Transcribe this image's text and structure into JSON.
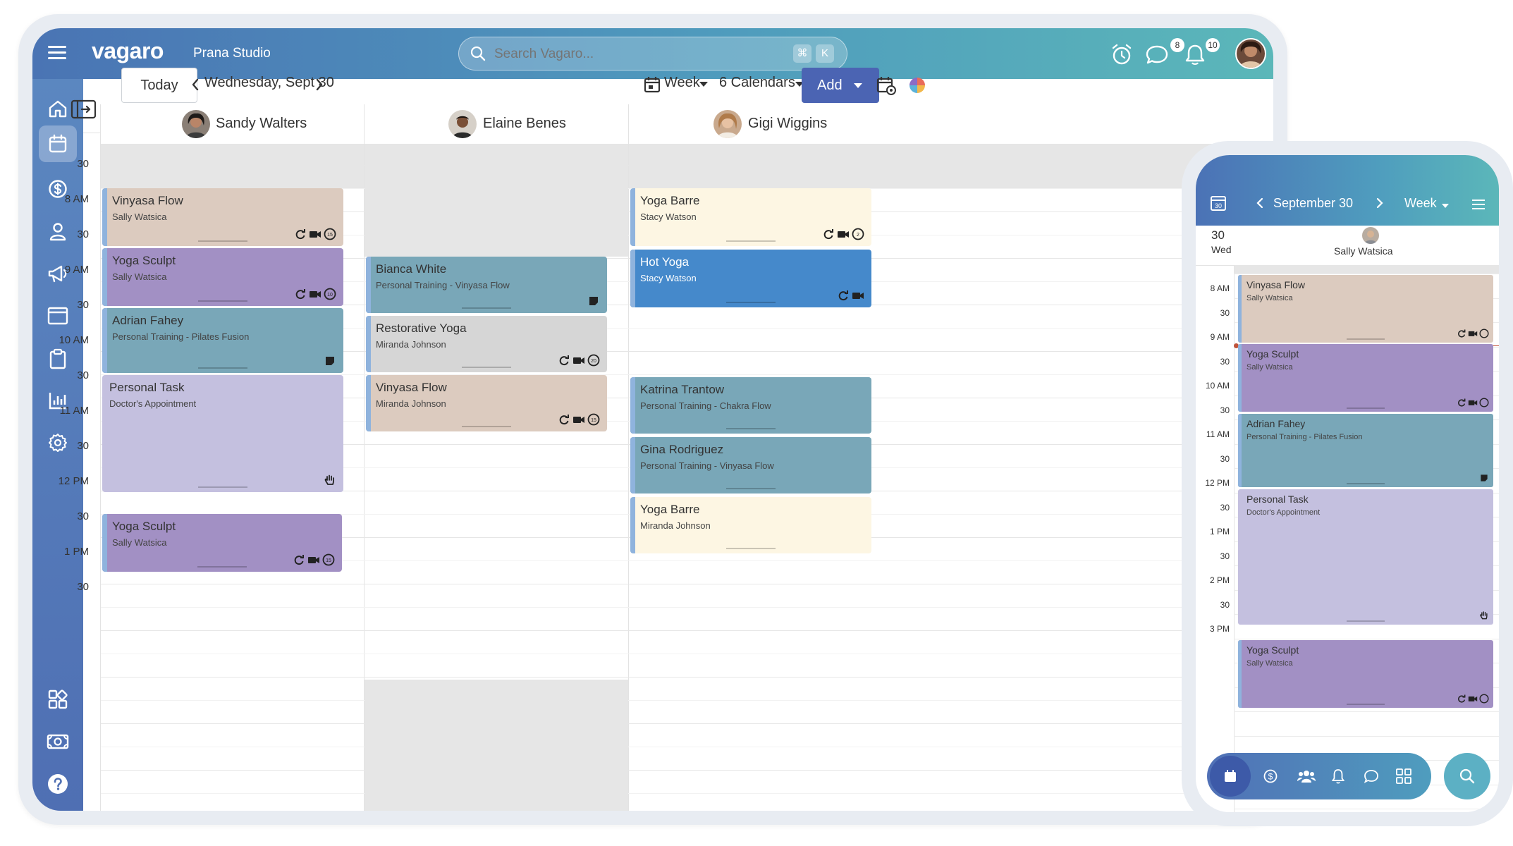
{
  "header": {
    "brand": "vagaro",
    "studio": "Prana Studio",
    "search_placeholder": "Search Vagaro...",
    "shortcut_keys": [
      "⌘",
      "K"
    ],
    "messages_badge": "8",
    "notifications_badge": "10"
  },
  "toolbar": {
    "today_label": "Today",
    "date_label": "Wednesday, Sept 30",
    "view_label": "Week",
    "calendars_label": "6 Calendars",
    "add_label": "Add"
  },
  "columns": [
    {
      "name": "Sandy Walters"
    },
    {
      "name": "Elaine Benes"
    },
    {
      "name": "Gigi Wiggins"
    }
  ],
  "time_labels": [
    "30",
    "8 AM",
    "30",
    "9 AM",
    "30",
    "10 AM",
    "30",
    "11 AM",
    "30",
    "12 PM",
    "30",
    "1 PM",
    "30"
  ],
  "appointments": [
    {
      "title": "Vinyasa Flow",
      "sub": "Sally Watsica",
      "icon_num": "15"
    },
    {
      "title": "Yoga Sculpt",
      "sub": "Sally Watsica",
      "icon_num": "10"
    },
    {
      "title": "Adrian Fahey",
      "sub": "Personal Training - Pilates Fusion"
    },
    {
      "title": "Personal Task",
      "sub": "Doctor's Appointment"
    },
    {
      "title": "Yoga Sculpt",
      "sub": "Sally Watsica",
      "icon_num": "15"
    },
    {
      "title": "Bianca White",
      "sub": "Personal Training - Vinyasa Flow"
    },
    {
      "title": "Restorative Yoga",
      "sub": "Miranda Johnson",
      "icon_num": "20"
    },
    {
      "title": "Vinyasa Flow",
      "sub": "Miranda Johnson",
      "icon_num": "15"
    },
    {
      "title": "Yoga Barre",
      "sub": "Stacy Watson",
      "icon_num": "2"
    },
    {
      "title": "Hot Yoga",
      "sub": "Stacy Watson"
    },
    {
      "title": "Katrina Trantow",
      "sub": "Personal Training - Chakra Flow"
    },
    {
      "title": "Gina Rodriguez",
      "sub": "Personal Training - Vinyasa Flow"
    },
    {
      "title": "Yoga Barre",
      "sub": "Miranda Johnson"
    }
  ],
  "colors": {
    "tan": "#dccbbf",
    "purple": "#a290c4",
    "teal": "#79a7b8",
    "lavender": "#c4c0df",
    "gray": "#d6d6d6",
    "cream": "#fdf6e3",
    "blue": "#4589cb",
    "add_button": "#4b64b3"
  },
  "phone": {
    "calendar_day": "30",
    "month_label": "September 30",
    "view_label": "Week",
    "day_num": "30",
    "day_name": "Wed",
    "staff_name": "Sally Watsica",
    "time_labels": [
      "8 AM",
      "30",
      "9 AM",
      "30",
      "10 AM",
      "30",
      "11 AM",
      "30",
      "12 PM",
      "30",
      "1 PM",
      "30",
      "2 PM",
      "30",
      "3 PM"
    ],
    "appointments": [
      {
        "title": "Vinyasa Flow",
        "sub": "Sally Watsica"
      },
      {
        "title": "Yoga Sculpt",
        "sub": "Sally Watsica"
      },
      {
        "title": "Adrian Fahey",
        "sub": "Personal Training - Pilates Fusion"
      },
      {
        "title": "Personal Task",
        "sub": "Doctor's Appointment"
      },
      {
        "title": "Yoga Sculpt",
        "sub": "Sally Watsica"
      }
    ]
  },
  "icons": {
    "sidebar": [
      "home-icon",
      "calendar-icon",
      "dollar-icon",
      "user-icon",
      "megaphone-icon",
      "window-icon",
      "clipboard-icon",
      "chart-icon",
      "gear-icon",
      "apps-icon",
      "cash-icon",
      "help-icon"
    ],
    "phone_nav": [
      "calendar-icon",
      "dollar-icon",
      "users-icon",
      "bell-icon",
      "chat-icon",
      "apps-icon",
      "search-icon"
    ]
  }
}
